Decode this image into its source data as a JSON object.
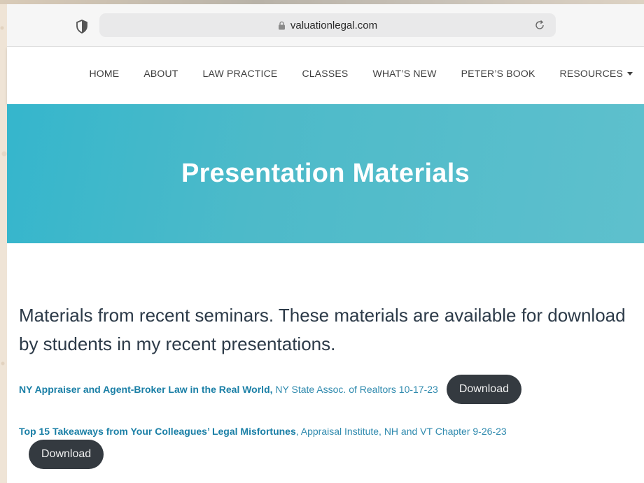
{
  "browser": {
    "url": "valuationlegal.com"
  },
  "nav": {
    "items": [
      "HOME",
      "ABOUT",
      "LAW PRACTICE",
      "CLASSES",
      "WHAT’S NEW",
      "PETER’S BOOK",
      "RESOURCES"
    ]
  },
  "hero": {
    "title": "Presentation Materials"
  },
  "content": {
    "intro": "Materials from recent seminars. These materials are available for download by students in my recent presentations.",
    "materials": [
      {
        "title": "NY Appraiser and Agent-Broker Law in the Real World,",
        "meta": " NY State Assoc. of Realtors 10-17-23",
        "button": "Download"
      },
      {
        "title": "Top 15 Takeaways from Your Colleagues’ Legal Misfortunes",
        "meta": ", Appraisal Institute, NH and VT Chapter 9-26-23",
        "button": "Download"
      }
    ]
  },
  "colors": {
    "hero_start": "#35b6cc",
    "hero_end": "#5ec0cd",
    "link": "#1a7fa6",
    "button_bg": "#343a40"
  }
}
